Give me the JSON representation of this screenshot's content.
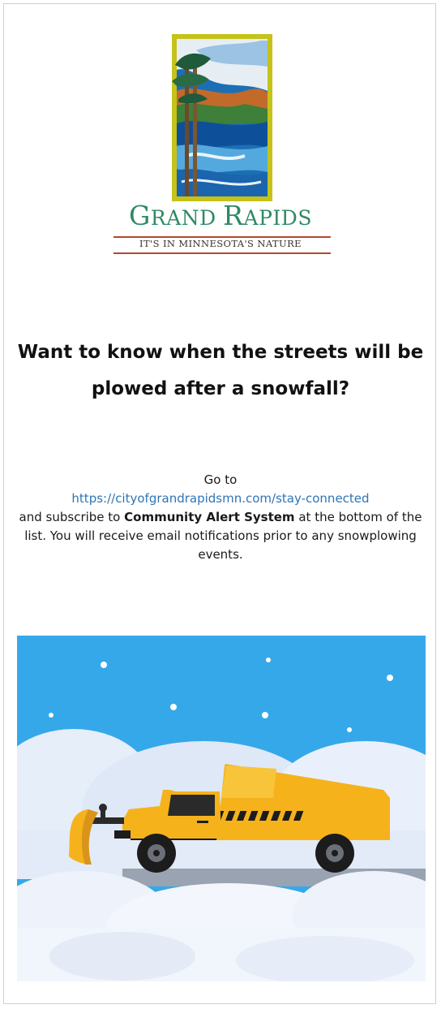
{
  "logo": {
    "name_cap_g": "G",
    "name_rest_1": "RAND ",
    "name_cap_r": "R",
    "name_rest_2": "APIDS",
    "tagline": "IT'S IN MINNESOTA'S NATURE",
    "colors": {
      "green": "#2e8a63",
      "rule": "#b14a2e",
      "frame": "#c5c21a"
    }
  },
  "headline": "Want to know when the streets will be plowed after a snowfall?",
  "body": {
    "line1": "Go to",
    "link": "https://cityofgrandrapidsmn.com/stay-connected",
    "text_before_bold": "and subscribe to ",
    "bold": "Community Alert System",
    "text_after_bold": " at the bottom of the list. You will receive email notifications prior to any snowplowing events."
  },
  "illustration": {
    "subject": "snowplow-truck",
    "colors": {
      "sky": "#35a8ea",
      "truck": "#f5b21b",
      "snow": "#eef3fb"
    }
  }
}
